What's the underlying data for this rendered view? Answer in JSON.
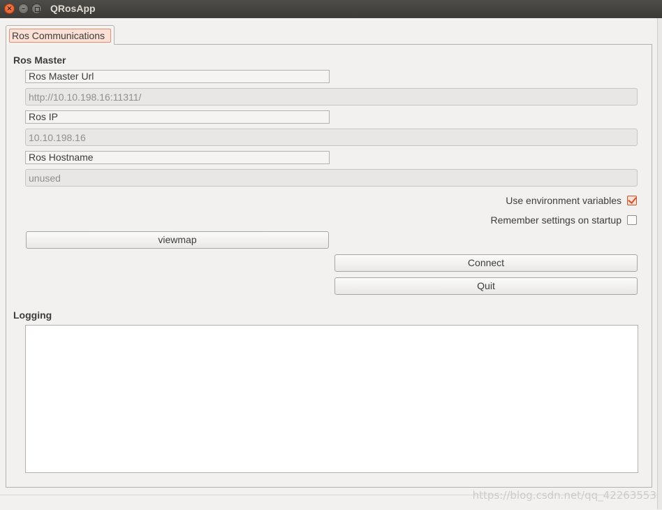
{
  "window": {
    "title": "QRosApp",
    "close_glyph": "×",
    "min_glyph": "–"
  },
  "tabs": [
    {
      "label": "Ros Communications",
      "active": true
    }
  ],
  "ros_master": {
    "group_title": "Ros Master",
    "master_url_label": "Ros Master Url",
    "master_url_value": "http://10.10.198.16:11311/",
    "ros_ip_label": "Ros IP",
    "ros_ip_value": "10.10.198.16",
    "hostname_label": "Ros Hostname",
    "hostname_value": "unused",
    "use_env_label": "Use environment variables",
    "use_env_checked": true,
    "remember_label": "Remember settings on startup",
    "remember_checked": false,
    "viewmap_label": "viewmap",
    "connect_label": "Connect",
    "quit_label": "Quit"
  },
  "logging": {
    "group_title": "Logging",
    "entries": []
  },
  "watermark": "https://blog.csdn.net/qq_42263553",
  "colors": {
    "accent": "#e95420",
    "titlebar": "#3c3b37",
    "window_bg": "#f2f1f0"
  },
  "icons": {
    "close": "close-icon",
    "minimize": "minimize-icon",
    "maximize": "maximize-icon",
    "checkmark": "check-icon"
  }
}
